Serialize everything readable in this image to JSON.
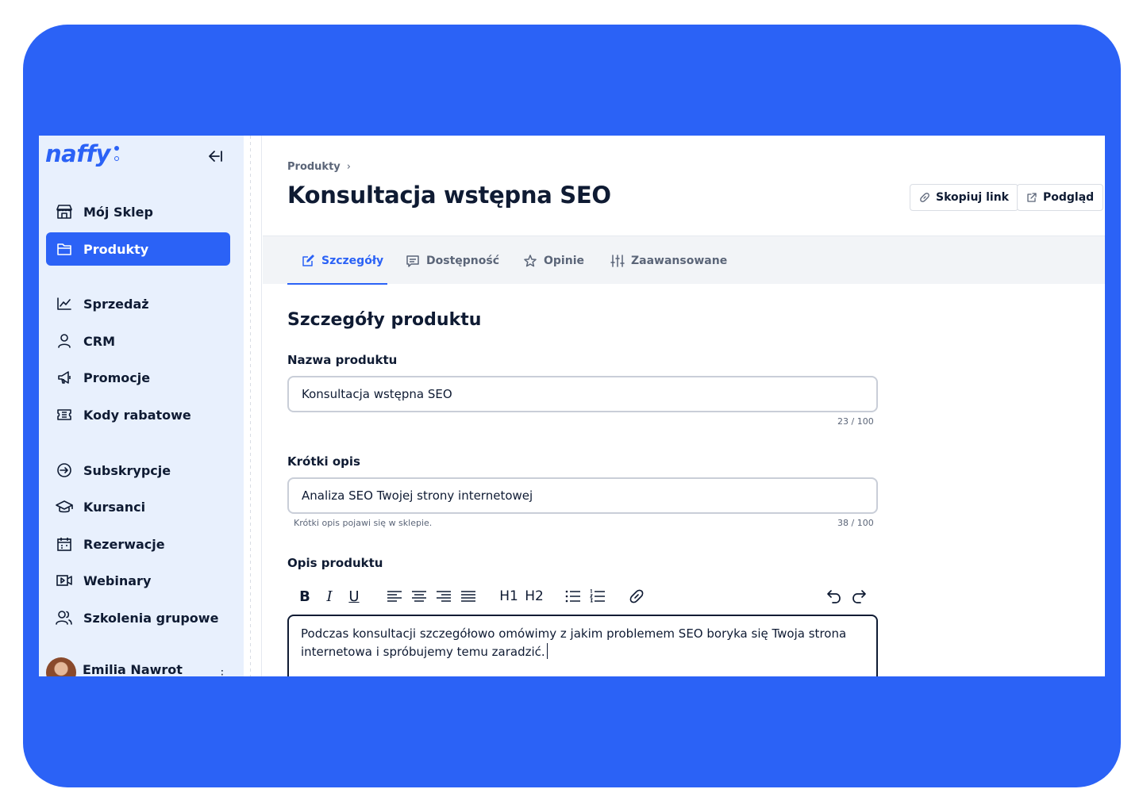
{
  "brand": {
    "logo_text": "naffy",
    "accent": "#2b62f6",
    "frame_bg": "#2b62f6",
    "sidebar_bg": "#e8f0fd"
  },
  "sidebar": {
    "items": [
      {
        "label": "Mój Sklep",
        "icon": "store-icon",
        "active": false
      },
      {
        "label": "Produkty",
        "icon": "folder-icon",
        "active": true
      },
      {
        "label": "Sprzedaż",
        "icon": "chart-line-icon",
        "active": false
      },
      {
        "label": "CRM",
        "icon": "user-icon",
        "active": false
      },
      {
        "label": "Promocje",
        "icon": "megaphone-icon",
        "active": false
      },
      {
        "label": "Kody rabatowe",
        "icon": "ticket-icon",
        "active": false
      },
      {
        "label": "Subskrypcje",
        "icon": "subscription-icon",
        "active": false
      },
      {
        "label": "Kursanci",
        "icon": "graduation-cap-icon",
        "active": false
      },
      {
        "label": "Rezerwacje",
        "icon": "calendar-icon",
        "active": false
      },
      {
        "label": "Webinary",
        "icon": "video-icon",
        "active": false
      },
      {
        "label": "Szkolenia grupowe",
        "icon": "users-icon",
        "active": false
      }
    ],
    "user": {
      "name": "Emilia Nawrot"
    }
  },
  "header": {
    "breadcrumb": "Produkty",
    "breadcrumb_separator": "›",
    "title": "Konsultacja wstępna SEO",
    "copy_link_label": "Skopiuj link",
    "preview_label": "Podgląd"
  },
  "tabs": [
    {
      "label": "Szczegóły",
      "icon": "edit-icon",
      "active": true
    },
    {
      "label": "Dostępność",
      "icon": "message-icon",
      "active": false
    },
    {
      "label": "Opinie",
      "icon": "star-icon",
      "active": false
    },
    {
      "label": "Zaawansowane",
      "icon": "sliders-icon",
      "active": false
    }
  ],
  "form": {
    "section_title": "Szczegóły produktu",
    "name": {
      "label": "Nazwa produktu",
      "value": "Konsultacja wstępna SEO",
      "counter": "23 / 100"
    },
    "short_desc": {
      "label": "Krótki opis",
      "value": "Analiza SEO Twojej strony internetowej",
      "hint": "Krótki opis pojawi się w sklepie.",
      "counter": "38 / 100"
    },
    "description": {
      "label": "Opis produktu",
      "toolbar": {
        "bold": "B",
        "italic": "I",
        "underline": "U",
        "h1": "H1",
        "h2": "H2"
      },
      "value": "Podczas konsultacji szczegółowo omówimy z jakim problemem SEO boryka się Twoja strona internetowa i spróbujemy temu zaradzić."
    }
  }
}
